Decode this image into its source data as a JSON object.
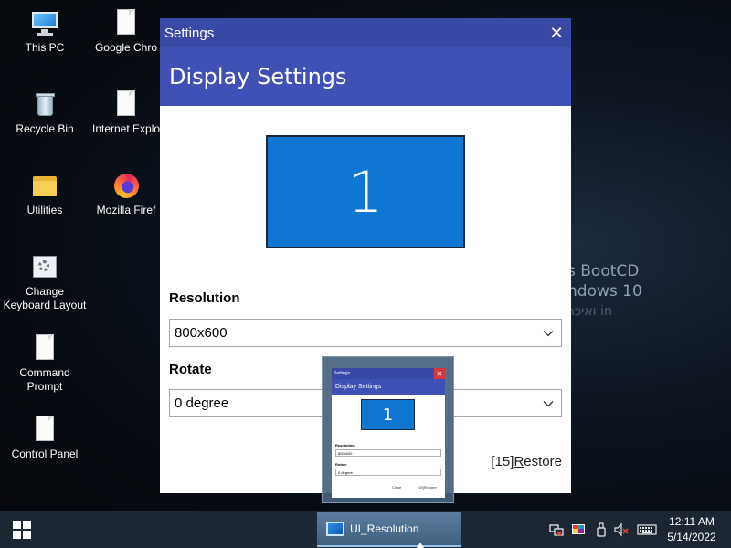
{
  "desktop": {
    "icons": [
      {
        "label": "This PC"
      },
      {
        "label": "Google Chro"
      },
      {
        "label": "Recycle Bin"
      },
      {
        "label": "Internet Explo"
      },
      {
        "label": "Utilities"
      },
      {
        "label": "Mozilla Firef"
      },
      {
        "label": "Change Keyboard Layout"
      },
      {
        "label": "Command Prompt"
      },
      {
        "label": "Control Panel"
      }
    ],
    "wallpaper_text": [
      "s BootCD",
      "ndows 10",
      "ואיכר in"
    ]
  },
  "window": {
    "title": "Settings",
    "close_glyph": "✕",
    "header": "Display Settings",
    "monitor_number": "1",
    "resolution_label": "Resolution",
    "resolution_value": "800x600",
    "rotate_label": "Rotate",
    "rotate_value": "0 degree",
    "restore_prefix": "[15]",
    "restore_accel": "R",
    "restore_rest": "estore"
  },
  "preview": {
    "title": "Settings",
    "header": "Display Settings",
    "monitor_number": "1",
    "resolution_label": "Resolution",
    "resolution_value": "800x600",
    "rotate_label": "Rotate",
    "rotate_value": "0 degree",
    "close_label": "Close",
    "restore_label": "[15]Restore"
  },
  "taskbar": {
    "app_label": "UI_Resolution",
    "time": "12:11 AM",
    "date": "5/14/2022"
  },
  "colors": {
    "titlebar": "#3a48a6",
    "header": "#3f51b5",
    "monitor": "#0f77d3",
    "taskbar": "#1d2633"
  }
}
